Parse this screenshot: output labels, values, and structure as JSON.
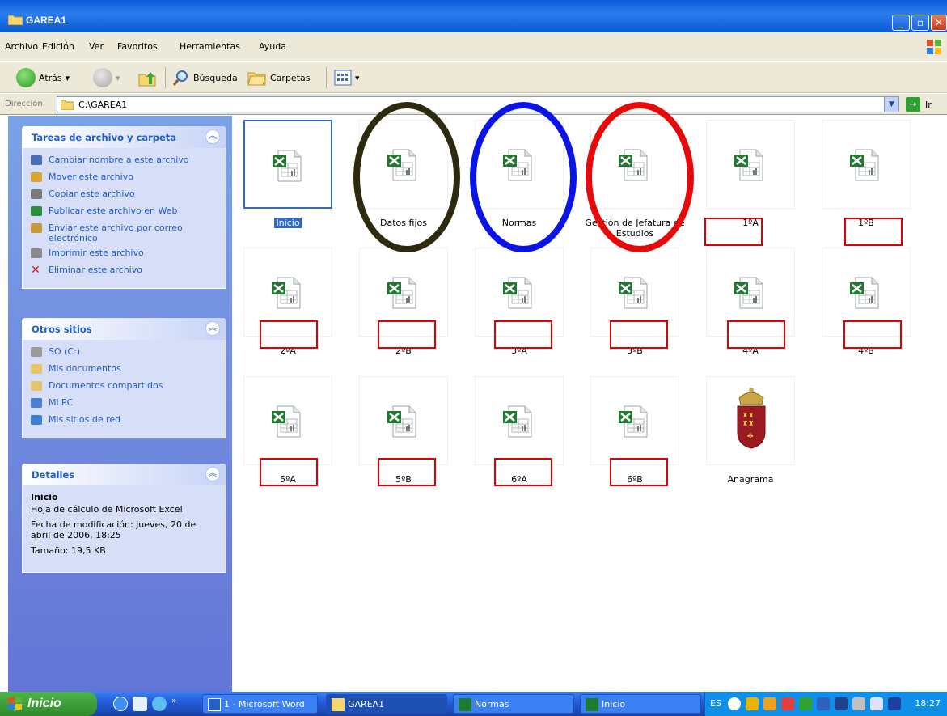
{
  "window": {
    "title": "GAREA1"
  },
  "menu": [
    "Archivo",
    "Edición",
    "Ver",
    "Favoritos",
    "Herramientas",
    "Ayuda"
  ],
  "toolbar": {
    "back": "Atrás",
    "search": "Búsqueda",
    "folders": "Carpetas"
  },
  "address": {
    "label": "Dirección",
    "path": "C:\\GAREA1",
    "go": "Ir"
  },
  "sidebar": {
    "tasks": {
      "title": "Tareas de archivo y carpeta",
      "items": [
        {
          "label": "Cambiar nombre a este archivo",
          "icon": "rename-icon"
        },
        {
          "label": "Mover este archivo",
          "icon": "move-icon"
        },
        {
          "label": "Copiar este archivo",
          "icon": "copy-icon"
        },
        {
          "label": "Publicar este archivo en Web",
          "icon": "publish-icon"
        },
        {
          "label": "Enviar este archivo por correo electrónico",
          "icon": "email-icon"
        },
        {
          "label": "Imprimir este archivo",
          "icon": "print-icon"
        },
        {
          "label": "Eliminar este archivo",
          "icon": "delete-icon"
        }
      ]
    },
    "places": {
      "title": "Otros sitios",
      "items": [
        {
          "label": "SO (C:)",
          "icon": "drive-icon"
        },
        {
          "label": "Mis documentos",
          "icon": "documents-icon"
        },
        {
          "label": "Documentos compartidos",
          "icon": "shared-folder-icon"
        },
        {
          "label": "Mi PC",
          "icon": "computer-icon"
        },
        {
          "label": "Mis sitios de red",
          "icon": "network-icon"
        }
      ]
    },
    "details": {
      "title": "Detalles",
      "name": "Inicio",
      "type": "Hoja de cálculo de Microsoft Excel",
      "modified": "Fecha de modificación: jueves, 20 de abril de 2006, 18:25",
      "size": "Tamaño: 19,5 KB"
    }
  },
  "files": [
    {
      "name": "Inicio",
      "selected": true
    },
    {
      "name": "Datos fijos"
    },
    {
      "name": "Normas"
    },
    {
      "name": "Gestión de Jefatura de Estudios"
    },
    {
      "name": "1ºA"
    },
    {
      "name": "1ºB"
    },
    {
      "name": "2ºA"
    },
    {
      "name": "2ºB"
    },
    {
      "name": "3ºA"
    },
    {
      "name": "3ºB"
    },
    {
      "name": "4ºA"
    },
    {
      "name": "4ºB"
    },
    {
      "name": "5ºA"
    },
    {
      "name": "5ºB"
    },
    {
      "name": "6ºA"
    },
    {
      "name": "6ºB"
    },
    {
      "name": "Anagrama",
      "icon": "coat-of-arms-icon"
    }
  ],
  "annotations": {
    "oval_colors": [
      "#2e2a10",
      "#0a14e6",
      "#e60a0a"
    ],
    "box_color": "#e00000"
  },
  "taskbar": {
    "start": "Inicio",
    "buttons": [
      "1 - Microsoft Word",
      "GAREA1",
      "Normas",
      "Inicio"
    ],
    "lang": "ES",
    "clock": "18:27"
  }
}
